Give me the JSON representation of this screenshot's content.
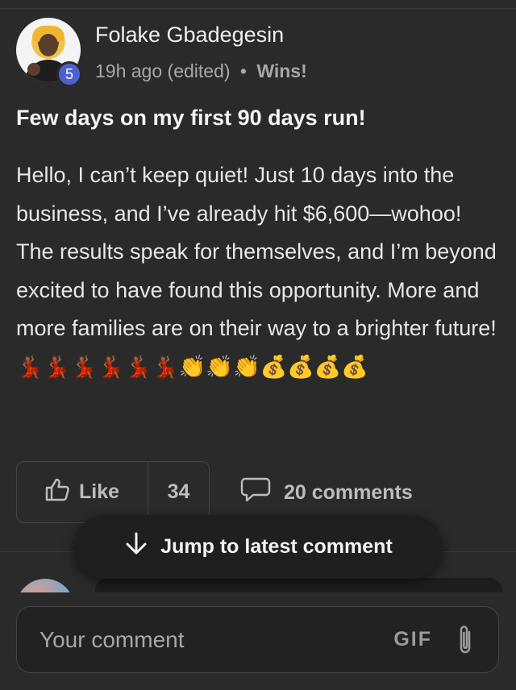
{
  "post": {
    "author": "Folake Gbadegesin",
    "level": "5",
    "time": "19h ago",
    "edited": "(edited)",
    "separator": "•",
    "category": "Wins!",
    "title": "Few days on my first 90 days run!",
    "body": "Hello, I can’t keep quiet! Just 10 days into the business, and I’ve already hit $6,600—wohoo! The results speak for themselves, and I’m beyond excited to have found this opportunity. More and more families are on their way to a brighter future!💃🏾💃🏾💃🏾💃🏾💃🏾💃🏾👏👏👏💰💰💰💰"
  },
  "actions": {
    "like_label": "Like",
    "like_count": "34",
    "comments_label": "20 comments"
  },
  "jump": {
    "label": "Jump to latest comment"
  },
  "composer": {
    "placeholder": "Your comment",
    "gif_label": "GIF"
  },
  "icons": {
    "like": "thumbs-up-icon",
    "comments": "comment-bubble-icon",
    "jump": "arrow-down-icon",
    "attach": "paperclip-icon"
  },
  "colors": {
    "background": "#2a2a2a",
    "badge": "#4b61d1",
    "pill": "#1f1f1f"
  }
}
